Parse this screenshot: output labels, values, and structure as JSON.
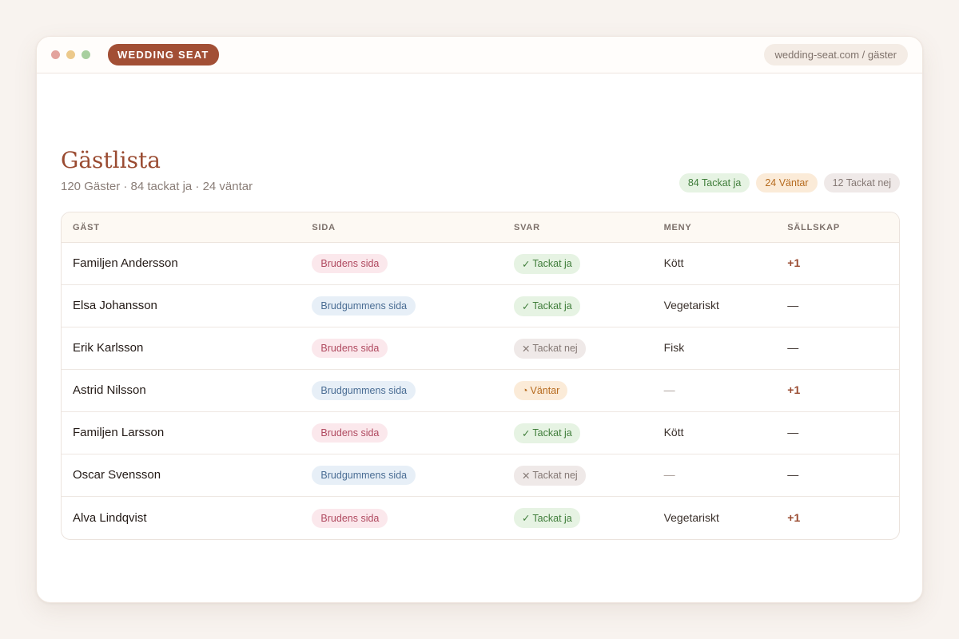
{
  "window": {
    "brand": "WEDDING SEAT",
    "url": "wedding-seat.com / gäster"
  },
  "page": {
    "title": "Gästlista",
    "subtitle": "120 Gäster · 84 tackat ja · 24 väntar",
    "summary": {
      "yes": "84 Tackat ja",
      "waiting": "24 Väntar",
      "no": "12 Tackat nej"
    }
  },
  "table": {
    "headers": {
      "guest": "GÄST",
      "side": "SIDA",
      "response": "SVAR",
      "menu": "MENY",
      "company": "SÄLLSKAP"
    },
    "rows": [
      {
        "guest": "Familjen Andersson",
        "side": "Brudens sida",
        "side_type": "bride",
        "response": "Tackat ja",
        "response_type": "yes",
        "response_icon": "✓",
        "menu": "Kött",
        "company": "+1"
      },
      {
        "guest": "Elsa Johansson",
        "side": "Brudgummens sida",
        "side_type": "groom",
        "response": "Tackat ja",
        "response_type": "yes",
        "response_icon": "✓",
        "menu": "Vegetariskt",
        "company": "—"
      },
      {
        "guest": "Erik Karlsson",
        "side": "Brudens sida",
        "side_type": "bride",
        "response": "Tackat nej",
        "response_type": "no",
        "response_icon": "✕",
        "menu": "Fisk",
        "company": "—"
      },
      {
        "guest": "Astrid Nilsson",
        "side": "Brudgummens sida",
        "side_type": "groom",
        "response": "Väntar",
        "response_type": "wait",
        "response_icon": "◔",
        "menu": "—",
        "company": "+1"
      },
      {
        "guest": "Familjen Larsson",
        "side": "Brudens sida",
        "side_type": "bride",
        "response": "Tackat ja",
        "response_type": "yes",
        "response_icon": "✓",
        "menu": "Kött",
        "company": "—"
      },
      {
        "guest": "Oscar Svensson",
        "side": "Brudgummens sida",
        "side_type": "groom",
        "response": "Tackat nej",
        "response_type": "no",
        "response_icon": "✕",
        "menu": "—",
        "company": "—"
      },
      {
        "guest": "Alva Lindqvist",
        "side": "Brudens sida",
        "side_type": "bride",
        "response": "Tackat ja",
        "response_type": "yes",
        "response_icon": "✓",
        "menu": "Vegetariskt",
        "company": "+1"
      }
    ]
  },
  "colors": {
    "accent": "#a24f35",
    "title": "#9a4b31",
    "yes": "#3f7d3a",
    "waiting": "#b66b1f",
    "no": "#857975",
    "bride": "#b04a60",
    "groom": "#4a6d94"
  }
}
